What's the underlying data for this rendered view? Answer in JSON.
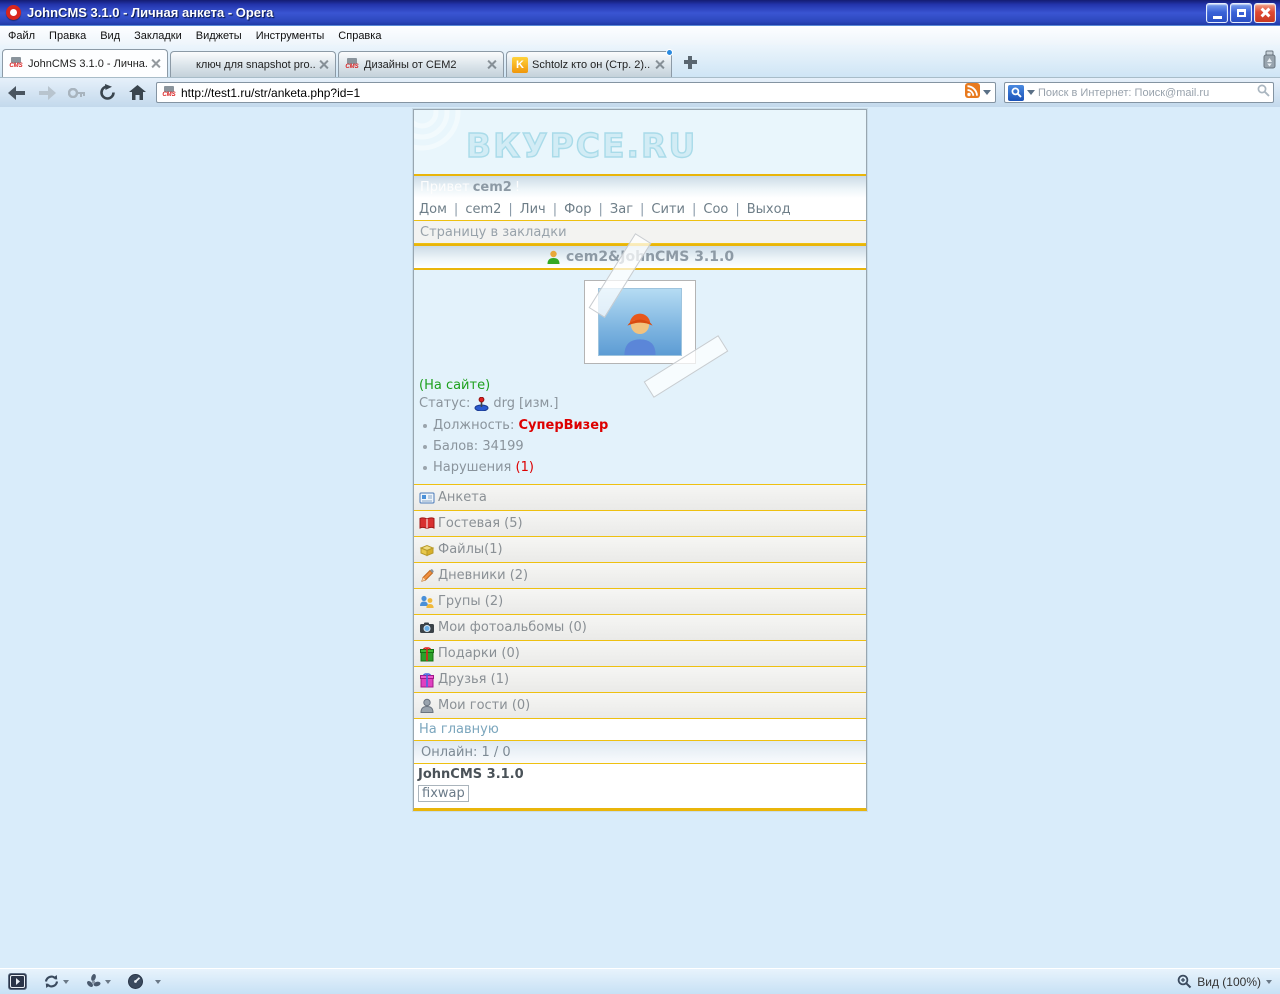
{
  "window": {
    "title": "JohnCMS 3.1.0 - Личная анкета - Opera"
  },
  "menubar": {
    "items": [
      "Файл",
      "Правка",
      "Вид",
      "Закладки",
      "Виджеты",
      "Инструменты",
      "Справка"
    ]
  },
  "tabbar": {
    "tabs": [
      {
        "favicon": "cms-icon",
        "label": "JohnCMS 3.1.0 - Лична..."
      },
      {
        "favicon": "google-icon",
        "label": "ключ для snapshot pro..."
      },
      {
        "favicon": "cms-icon",
        "label": "Дизайны от CEM2"
      },
      {
        "favicon": "k-icon",
        "label": "Schtolz кто он (Стр. 2)..."
      }
    ]
  },
  "toolbar": {
    "url": "http://test1.ru/str/anketa.php?id=1",
    "search_placeholder": "Поиск в Интернет: Поиск@mail.ru"
  },
  "content": {
    "logo": "ВКУРСЕ.RU",
    "greeting": {
      "prefix": "Привет",
      "username": "cem2",
      "suffix": "!"
    },
    "nav": {
      "separator": "|",
      "links": [
        "Дом",
        "cem2",
        "Лич",
        "Фор",
        "Заг",
        "Сити",
        "Соо",
        "Выход"
      ]
    },
    "bookmark": "Страницу в закладки",
    "user_header": "cem2&JohnCMS 3.1.0",
    "profile": {
      "online": "(На сайте)",
      "status_label": "Статус:",
      "status_value": "drg",
      "status_edit": "[изм.]",
      "position_label": "Должность:",
      "position_value": "СуперВизер",
      "points_label": "Балов:",
      "points_value": "34199",
      "violations_label": "Нарушения",
      "violations_count": "(1)"
    },
    "menu": {
      "items": [
        {
          "icon": "vcard-icon",
          "label": "Анкета"
        },
        {
          "icon": "guestbook-icon",
          "label": "Гостевая (5)"
        },
        {
          "icon": "files-icon",
          "label": "Файлы(1)"
        },
        {
          "icon": "diary-icon",
          "label": "Дневники (2)"
        },
        {
          "icon": "groups-icon",
          "label": "Групы (2)"
        },
        {
          "icon": "photos-icon",
          "label": "Мои фотоальбомы (0)"
        },
        {
          "icon": "gifts-icon",
          "label": "Подарки (0)"
        },
        {
          "icon": "friends-icon",
          "label": "Друзья (1)"
        },
        {
          "icon": "guests-icon",
          "label": "Мои гости (0)"
        }
      ]
    },
    "home_link": "На главную",
    "online_counter": "Онлайн: 1 / 0",
    "footer": {
      "title": "JohnCMS 3.1.0",
      "link": "fixwap"
    }
  },
  "statusbar": {
    "zoom_label": "Вид (100%)"
  },
  "colors": {
    "accent_gold": "#e9b50a",
    "status_red": "#dd0000",
    "online_green": "#1ea01e",
    "text_gray": "#8a949c",
    "titlebar_blue": "#3a55d2"
  }
}
